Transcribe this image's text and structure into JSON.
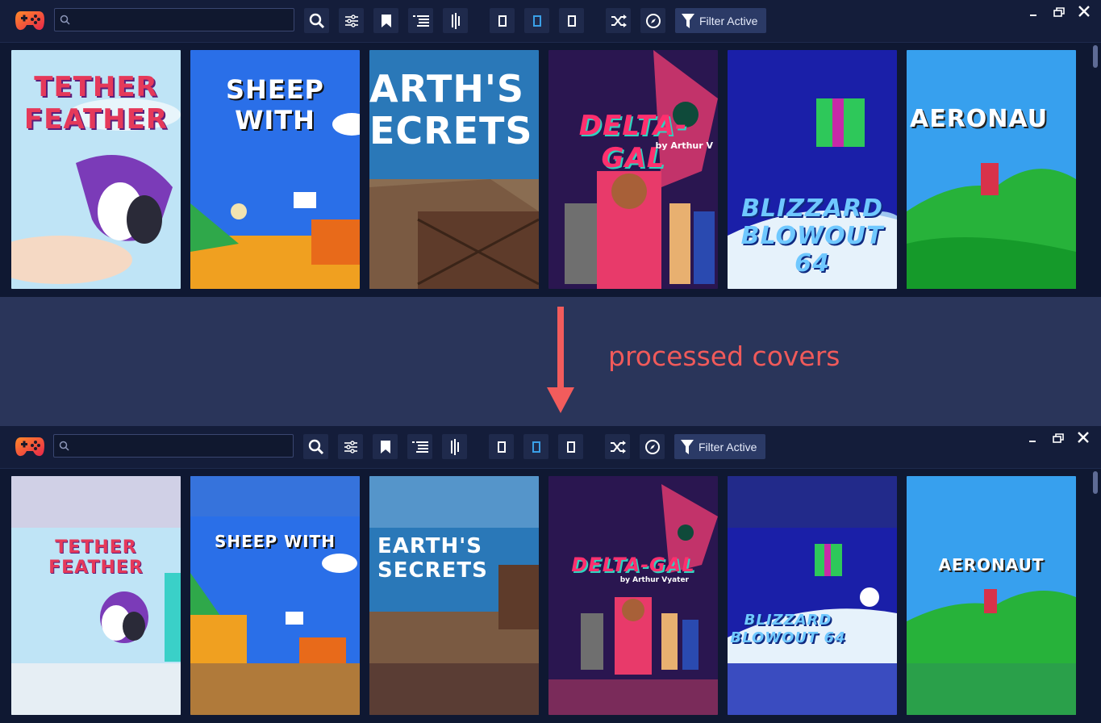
{
  "top_panel": {
    "search": {
      "value": "",
      "placeholder": ""
    },
    "filter_label": "Filter Active",
    "covers": [
      {
        "title": "TETHER FEATHER",
        "state": "original"
      },
      {
        "title": "SHEEP WITH",
        "state": "original"
      },
      {
        "title": "ARTH'S ECRETS",
        "state": "original"
      },
      {
        "title": "DELTA-GAL",
        "subtitle": "by Arthur V",
        "state": "original"
      },
      {
        "title": "BLIZZARD BLOWOUT 64",
        "state": "original"
      },
      {
        "title": "AERONAU",
        "state": "original"
      }
    ]
  },
  "caption": "processed covers",
  "bottom_panel": {
    "search": {
      "value": "",
      "placeholder": ""
    },
    "filter_label": "Filter Active",
    "covers": [
      {
        "title": "TETHER FEATHER",
        "state": "processed"
      },
      {
        "title": "SHEEP WITH",
        "state": "processed"
      },
      {
        "title": "EARTH'S SECRETS",
        "state": "processed"
      },
      {
        "title": "DELTA-GAL",
        "subtitle": "by Arthur Vyater",
        "state": "processed"
      },
      {
        "title": "BLIZZARD BLOWOUT 64",
        "state": "processed"
      },
      {
        "title": "AERONAUT",
        "state": "processed"
      }
    ]
  },
  "icons": {
    "toolbar": [
      "gamepad-logo-icon",
      "search-icon",
      "sliders-icon",
      "bookmark-icon",
      "list-icon",
      "sort-icon",
      "view-small-icon",
      "view-medium-icon",
      "view-large-icon",
      "shuffle-icon",
      "compass-icon",
      "filter-icon"
    ],
    "window": [
      "minimize-icon",
      "restore-icon",
      "close-icon"
    ]
  },
  "colors": {
    "background": "#2a355a",
    "panel": "#0f1832",
    "toolbar": "#141d3a",
    "accent": "#3aa0e8",
    "caption": "#f05a5a",
    "arrow": "#f25c5c"
  }
}
